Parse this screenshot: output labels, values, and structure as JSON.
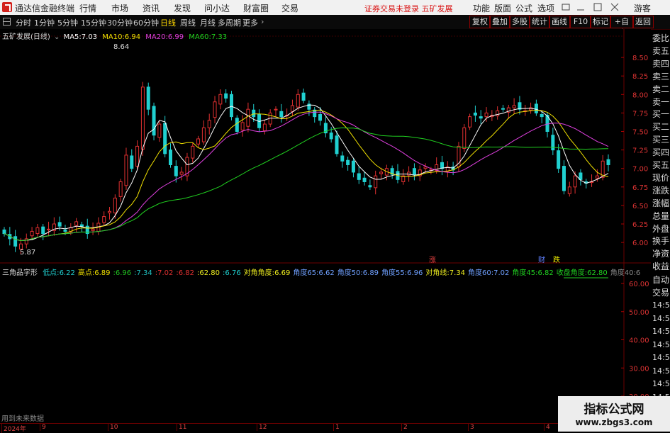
{
  "window": {
    "app_title": "通达信金融终端",
    "menus": [
      "行情",
      "市场",
      "资讯",
      "发现",
      "问小达",
      "财富圈",
      "交易"
    ],
    "alert": "证券交易未登录  五矿发展",
    "right_menus": [
      "功能",
      "版面",
      "公式",
      "选项"
    ],
    "guest": "游客"
  },
  "toolbar": {
    "periods": [
      "分时",
      "1分钟",
      "5分钟",
      "15分钟",
      "30分钟",
      "60分钟",
      "日线",
      "周线",
      "月线",
      "多周期",
      "更多"
    ],
    "active_period": "日线",
    "right_buttons": [
      "复权",
      "叠加",
      "多股",
      "统计",
      "画线",
      "F10",
      "标记",
      "+自选",
      "返回"
    ]
  },
  "main_chart": {
    "stock_label": "五矿发展(日线)",
    "ma": [
      {
        "label": "MA5:",
        "value": "7.03",
        "color": "#ffffff"
      },
      {
        "label": "MA10:",
        "value": "6.94",
        "color": "#f0e000"
      },
      {
        "label": "MA20:",
        "value": "6.99",
        "color": "#e040e0"
      },
      {
        "label": "MA60:",
        "value": "7.33",
        "color": "#20d020"
      }
    ],
    "high_mark": "8.64",
    "low_mark": "5.87",
    "price_ticks": [
      "8.50",
      "8.25",
      "8.00",
      "7.75",
      "7.50",
      "7.25",
      "7.00",
      "6.75",
      "6.50",
      "6.25",
      "6.00"
    ],
    "event_marks": [
      {
        "text": "涨",
        "color": "#e04040"
      },
      {
        "text": "财",
        "color": "#6080ff"
      },
      {
        "text": "跌",
        "color": "#e0e000"
      }
    ]
  },
  "indicator": {
    "name": "三角品字形",
    "items": [
      {
        "text": "低点:",
        "value": "6.22",
        "color": "#20d0d0"
      },
      {
        "text": "高点:",
        "value": "6.89",
        "color": "#f0e000"
      },
      {
        "text": ":",
        "value": "6.96",
        "color": "#20c020"
      },
      {
        "text": ":",
        "value": "7.34",
        "color": "#20c0c0"
      },
      {
        "text": ":",
        "value": "7.02",
        "color": "#e03030"
      },
      {
        "text": ":",
        "value": "6.82",
        "color": "#e03030"
      },
      {
        "text": ":",
        "value": "62.80",
        "color": "#f0f020"
      },
      {
        "text": ":",
        "value": "6.76",
        "color": "#20d0d0"
      },
      {
        "text": "对角角度:",
        "value": "6.69",
        "color": "#f0f020"
      },
      {
        "text": "角度65:",
        "value": "6.62",
        "color": "#6fa0ff"
      },
      {
        "text": "角度50:",
        "value": "6.89",
        "color": "#6fa0ff"
      },
      {
        "text": "角度55:",
        "value": "6.96",
        "color": "#6fa0ff"
      },
      {
        "text": "对角线:",
        "value": "7.34",
        "color": "#f0f020"
      },
      {
        "text": "角度60:",
        "value": "7.02",
        "color": "#6fa0ff"
      },
      {
        "text": "角度45:",
        "value": "6.82",
        "color": "#20d020"
      },
      {
        "text": "收盘角度:",
        "value": "62.80",
        "color": "#20d020"
      },
      {
        "text": "角度40:",
        "value": "6",
        "color": "#888888"
      }
    ],
    "ticks": [
      "60.00",
      "50.00",
      "40.00",
      "30.00",
      "20.00"
    ]
  },
  "right_panel": {
    "labels": [
      "委比",
      "卖五",
      "卖四",
      "卖三",
      "卖二",
      "卖一",
      "买一",
      "买二",
      "买三",
      "买四",
      "买五",
      "现价",
      "涨跌",
      "涨幅",
      "总量",
      "外盘",
      "换手",
      "净资",
      "收益"
    ],
    "lower_labels": [
      "自动",
      "交易"
    ],
    "times": [
      "14:56",
      "14:56",
      "14:56",
      "14:56",
      "14:56",
      "14:56",
      "14:56",
      "14:56"
    ]
  },
  "bottom": {
    "future_data_text": "用到未来数据",
    "date_labels": [
      "2024年",
      "9",
      "10",
      "11",
      "12",
      "1",
      "2",
      "3",
      "4"
    ]
  },
  "watermark": {
    "line1": "指标公式网",
    "line2": "www.zbgs3.com"
  },
  "chart_data": {
    "type": "candlestick",
    "title": "五矿发展(日线)",
    "ylim": [
      5.8,
      8.75
    ],
    "y_ticks": [
      6.0,
      6.25,
      6.5,
      6.75,
      7.0,
      7.25,
      7.5,
      7.75,
      8.0,
      8.25,
      8.5
    ],
    "annotations": [
      {
        "text": "8.64",
        "value": 8.64
      },
      {
        "text": "5.87",
        "value": 5.87
      }
    ],
    "close": [
      6.12,
      6.05,
      5.95,
      5.98,
      6.05,
      6.15,
      6.2,
      6.12,
      6.18,
      6.25,
      6.22,
      6.15,
      6.2,
      6.28,
      6.22,
      6.12,
      6.18,
      6.26,
      6.35,
      6.42,
      6.6,
      6.82,
      7.18,
      7.0,
      7.3,
      8.1,
      7.8,
      7.45,
      7.6,
      7.2,
      7.05,
      6.9,
      6.95,
      7.15,
      7.3,
      7.4,
      7.55,
      7.65,
      7.9,
      8.0,
      7.95,
      7.7,
      7.5,
      7.62,
      7.8,
      7.7,
      7.55,
      7.6,
      7.75,
      7.8,
      7.7,
      7.72,
      7.85,
      8.0,
      7.92,
      7.8,
      7.7,
      7.65,
      7.48,
      7.4,
      7.2,
      7.1,
      7.05,
      6.95,
      6.85,
      6.82,
      6.75,
      6.9,
      6.95,
      7.0,
      6.92,
      6.85,
      6.9,
      6.95,
      6.92,
      6.98,
      7.02,
      6.98,
      7.05,
      7.0,
      7.02,
      6.98,
      7.3,
      7.55,
      7.7,
      7.72,
      7.68,
      7.75,
      7.72,
      7.78,
      7.8,
      7.82,
      7.85,
      7.8,
      7.78,
      7.82,
      7.75,
      7.7,
      7.5,
      7.25,
      7.0,
      6.7,
      6.75,
      6.9,
      6.85,
      6.8,
      6.82,
      6.9,
      7.1,
      7.05
    ]
  }
}
